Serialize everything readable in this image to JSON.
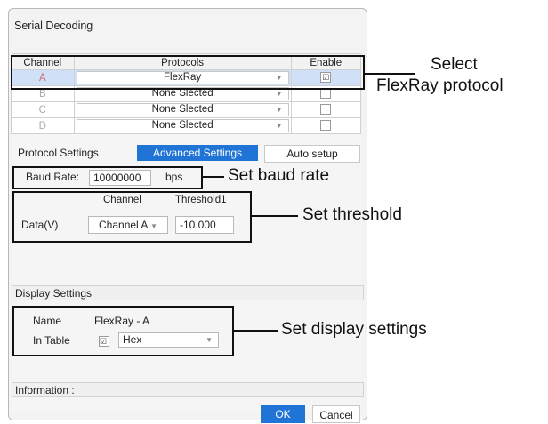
{
  "dialog": {
    "title": "Serial Decoding"
  },
  "protocol_table": {
    "headers": [
      "Channel",
      "Protocols",
      "Enable"
    ],
    "rows": [
      {
        "channel": "A",
        "protocol": "FlexRay",
        "enabled": "☑"
      },
      {
        "channel": "B",
        "protocol": "None Slected",
        "enabled": ""
      },
      {
        "channel": "C",
        "protocol": "None Slected",
        "enabled": ""
      },
      {
        "channel": "D",
        "protocol": "None Slected",
        "enabled": ""
      }
    ]
  },
  "tabs": {
    "protocol_settings": "Protocol Settings",
    "advanced_settings": "Advanced Settings",
    "auto_setup": "Auto setup"
  },
  "baud": {
    "label": "Baud Rate:",
    "value": "10000000",
    "unit": "bps"
  },
  "threshold": {
    "channel_header": "Channel",
    "threshold_header": "Threshold1",
    "row_label": "Data(V)",
    "channel_value": "Channel A",
    "threshold_value": "-10.000"
  },
  "display": {
    "section_label": "Display Settings",
    "name_label": "Name",
    "name_value": "FlexRay - A",
    "in_table_label": "In Table",
    "in_table_checked": "☑",
    "format_value": "Hex"
  },
  "information": {
    "label": "Information :"
  },
  "buttons": {
    "ok": "OK",
    "cancel": "Cancel"
  },
  "callouts": {
    "select_line1": "Select",
    "select_line2": "FlexRay protocol",
    "baud": "Set baud rate",
    "threshold": "Set threshold",
    "display": "Set display settings"
  },
  "colors": {
    "accent": "#1f74d6",
    "selected_row": "#cfe0f7",
    "highlight": "#111111"
  }
}
